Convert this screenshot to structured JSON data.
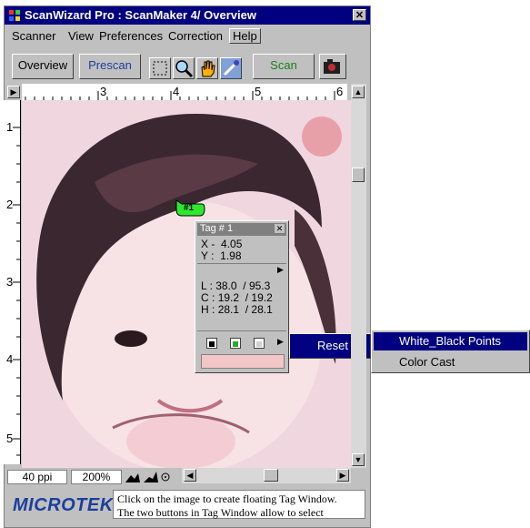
{
  "window": {
    "title": "ScanWizard Pro : ScanMaker 4/ Overview",
    "close_label": "✕"
  },
  "menu": {
    "items": [
      "Scanner",
      "View",
      "Preferences",
      "Correction",
      "Help"
    ]
  },
  "toolbar": {
    "overview_label": "Overview",
    "prescan_label": "Prescan",
    "scan_label": "Scan"
  },
  "icons": [
    "frame-select-icon",
    "zoom-icon",
    "hand-pan-icon",
    "eyedropper-icon",
    "camera-icon"
  ],
  "ruler": {
    "top_numbers": [
      "3",
      "4",
      "5",
      "6"
    ],
    "left_numbers": [
      "1",
      "2",
      "3",
      "4",
      "5"
    ]
  },
  "tag_marker": {
    "label": "#1"
  },
  "tag_window": {
    "title": "Tag # 1",
    "x_label": "X",
    "x_value": "4.05",
    "y_label": "Y",
    "y_value": "1.98",
    "l_label": "L",
    "l_values": [
      "38.0",
      "95.3"
    ],
    "c_label": "C",
    "c_values": [
      "19.2",
      "19.2"
    ],
    "h_label": "H",
    "h_values": [
      "28.1",
      "28.1"
    ],
    "swatch_color": "#f3c6c6"
  },
  "context_menu": {
    "reset_label": "Reset",
    "submenu": [
      "White_Black Points",
      "Color Cast"
    ]
  },
  "status": {
    "resolution": "40 ppi",
    "zoom": "200%"
  },
  "brand": {
    "logo": "MICROTEK"
  },
  "message": {
    "line1": "Click on the image to create floating Tag Window.",
    "line2": "The two buttons in Tag Window allow to select"
  },
  "colors": {
    "titlebar": "#000080",
    "menu_highlight": "#000080",
    "tag_marker": "#2ee82e",
    "logo": "#1a3f9c"
  }
}
